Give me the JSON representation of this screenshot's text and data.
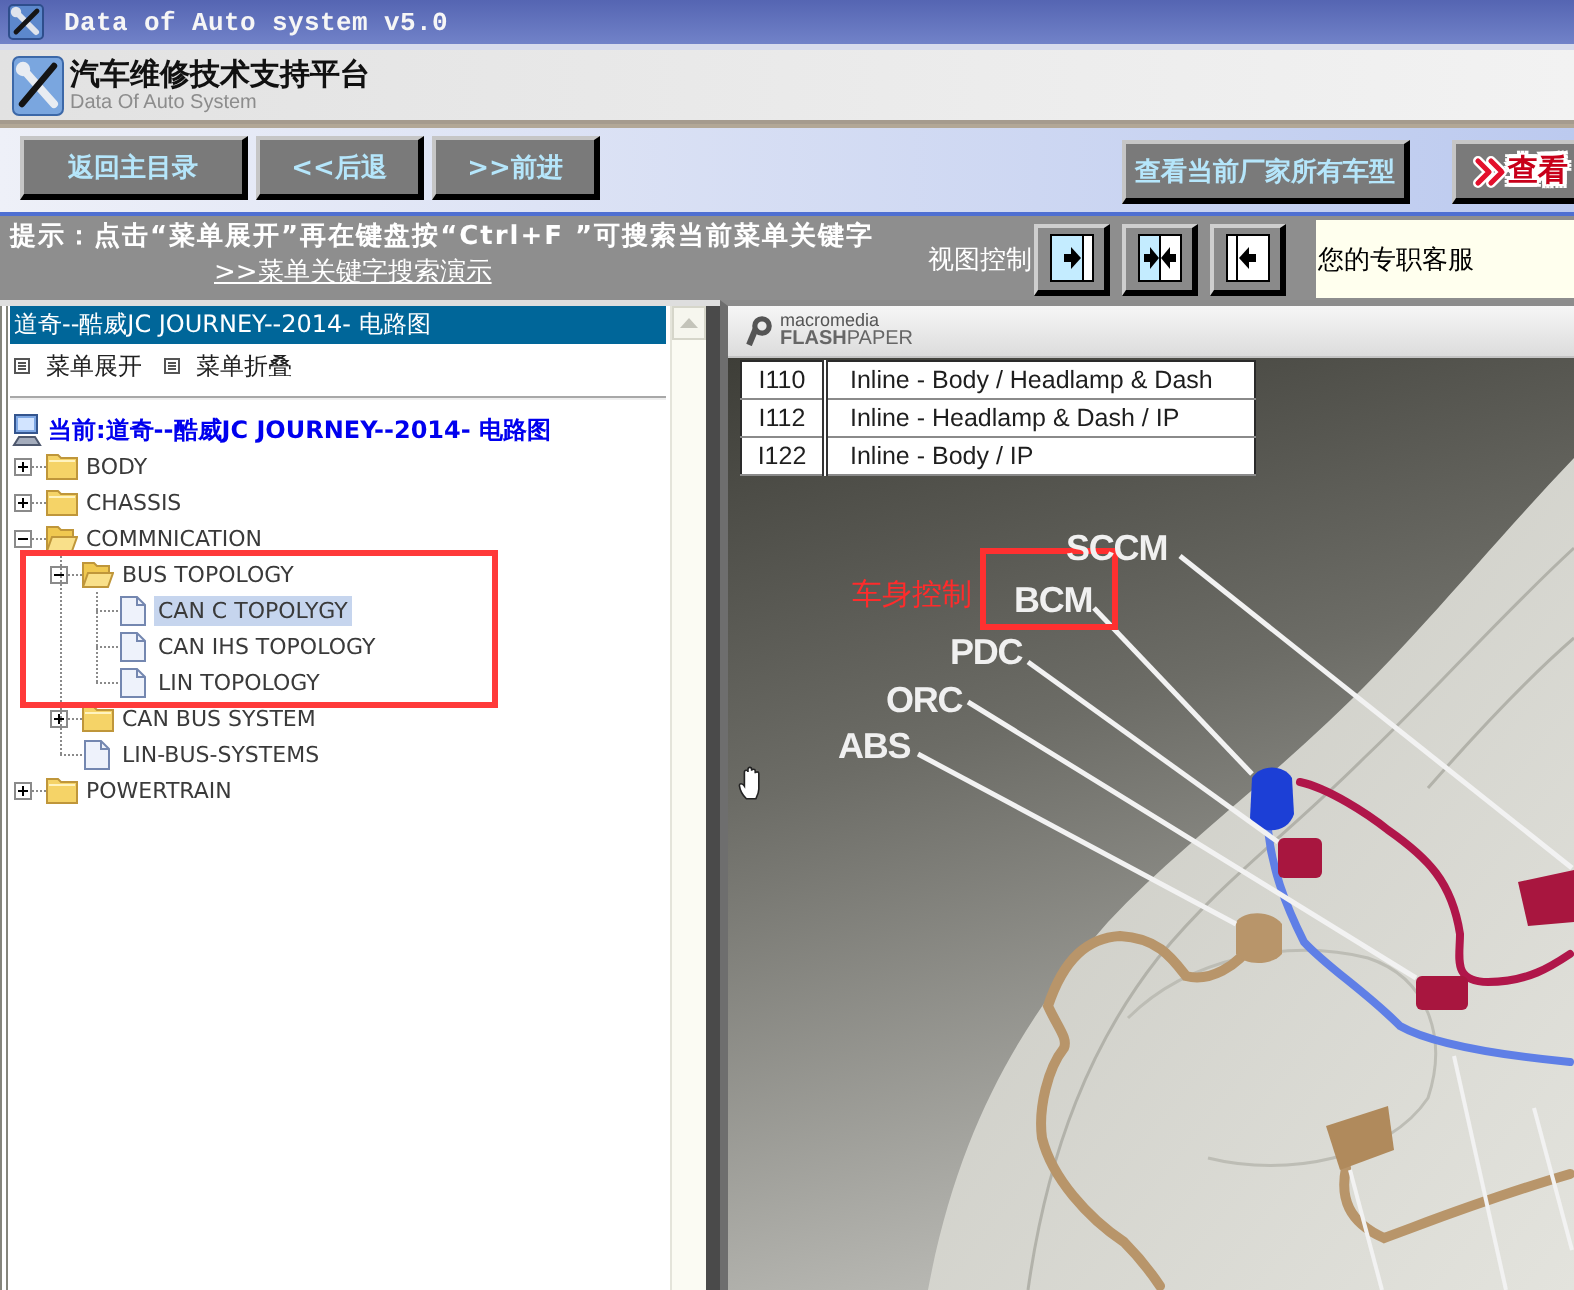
{
  "window": {
    "title": "Data of Auto system v5.0"
  },
  "header": {
    "title": "汽车维修技术支持平台",
    "subtitle": "Data Of Auto System"
  },
  "toolbar": {
    "nav_buttons": [
      "返回主目录",
      "<<后退",
      ">>前进"
    ],
    "right_buttons": [
      {
        "label": "查看当前厂家所有车型",
        "kind": "plain"
      },
      {
        "label": "查看",
        "kind": "highlight"
      }
    ]
  },
  "hint_bar": {
    "text": "提示：点击“菜单展开”再在键盘按“Ctrl+F ”可搜索当前菜单关键字",
    "link": ">>菜单关键字搜索演示",
    "view_label": "视图控制",
    "service": "您的专职客服"
  },
  "sidebar": {
    "title": "道奇--酷威JC JOURNEY--2014- 电路图",
    "actions": [
      "菜单展开",
      "菜单折叠"
    ],
    "tree": {
      "root": "当前:道奇--酷威JC JOURNEY--2014- 电路图",
      "items": [
        {
          "label": "BODY",
          "kind": "folder",
          "expanded": false,
          "selected": false
        },
        {
          "label": "CHASSIS",
          "kind": "folder",
          "expanded": false,
          "selected": false
        },
        {
          "label": "COMMNICATION",
          "kind": "folder",
          "expanded": true,
          "selected": false,
          "children": [
            {
              "label": "BUS TOPOLOGY",
              "kind": "folder",
              "expanded": true,
              "selected": false,
              "children": [
                {
                  "label": "CAN C TOPOLYGY",
                  "kind": "file",
                  "selected": true
                },
                {
                  "label": "CAN IHS TOPOLOGY",
                  "kind": "file",
                  "selected": false
                },
                {
                  "label": "LIN TOPOLOGY",
                  "kind": "file",
                  "selected": false
                }
              ]
            },
            {
              "label": "CAN BUS SYSTEM",
              "kind": "folder",
              "expanded": false,
              "selected": false
            },
            {
              "label": "LIN-BUS-SYSTEMS",
              "kind": "file",
              "selected": false
            }
          ]
        },
        {
          "label": "POWERTRAIN",
          "kind": "folder",
          "expanded": false,
          "selected": false
        }
      ]
    }
  },
  "viewer": {
    "logo": [
      "macromedia",
      "**FLASH**PAPER"
    ],
    "table": {
      "rows": [
        [
          "I110",
          "Inline - Body / Headlamp & Dash"
        ],
        [
          "I112",
          "Inline - Headlamp & Dash / IP"
        ],
        [
          "I122",
          "Inline - Body / IP"
        ]
      ]
    },
    "callouts": [
      "SCCM",
      "BCM",
      "PDC",
      "ORC",
      "ABS"
    ],
    "note": "车身控制"
  }
}
